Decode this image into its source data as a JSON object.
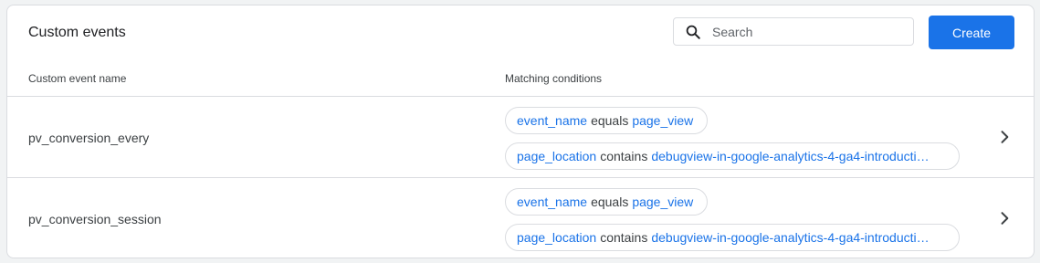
{
  "header": {
    "title": "Custom events",
    "search_placeholder": "Search",
    "create_label": "Create"
  },
  "table": {
    "columns": [
      "Custom event name",
      "Matching conditions"
    ],
    "rows": [
      {
        "name": "pv_conversion_every",
        "conditions": [
          {
            "field": "event_name",
            "operator": "equals",
            "value": "page_view"
          },
          {
            "field": "page_location",
            "operator": "contains",
            "value": "debugview-in-google-analytics-4-ga4-introducti…"
          }
        ]
      },
      {
        "name": "pv_conversion_session",
        "conditions": [
          {
            "field": "event_name",
            "operator": "equals",
            "value": "page_view"
          },
          {
            "field": "page_location",
            "operator": "contains",
            "value": "debugview-in-google-analytics-4-ga4-introducti…"
          }
        ]
      }
    ]
  },
  "icons": {
    "search": "search-icon",
    "row_open": "chevron-right-icon"
  },
  "colors": {
    "accent": "#1a73e8",
    "text": "#3c4043",
    "border": "#dadce0"
  }
}
